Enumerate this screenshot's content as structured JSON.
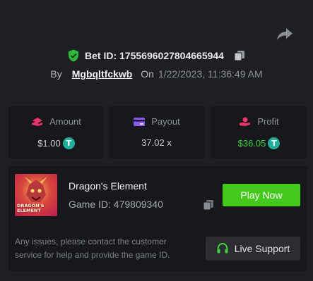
{
  "header": {
    "bet_id_label": "Bet ID: 1755696027804665944",
    "by_label": "By",
    "username": "Mgbqltfckwb",
    "on_label": "On",
    "date": "1/22/2023, 11:36:49 AM"
  },
  "stats": {
    "amount": {
      "label": "Amount",
      "value": "$1.00",
      "icon": "coin-hand-icon",
      "color": "#e8336b"
    },
    "payout": {
      "label": "Payout",
      "value": "37.02 x",
      "icon": "card-icon",
      "color": "#8c58f0"
    },
    "profit": {
      "label": "Profit",
      "value": "$36.05",
      "icon": "hand-coin-icon",
      "color": "#e8336b"
    }
  },
  "token_symbol": "T",
  "game": {
    "name": "Dragon's Element",
    "id_label": "Game ID: 479809340",
    "thumbnail_text": "DRAGON'S ELEMENT",
    "play_label": "Play Now"
  },
  "support": {
    "notice": "Any issues, please contact the customer service for help and provide the game ID.",
    "button_label": "Live Support"
  },
  "colors": {
    "background": "#1e1f23",
    "panel": "#17181b",
    "accent_green": "#43c91b",
    "profit_green": "#3fcf3f",
    "token": "#23b09a"
  }
}
